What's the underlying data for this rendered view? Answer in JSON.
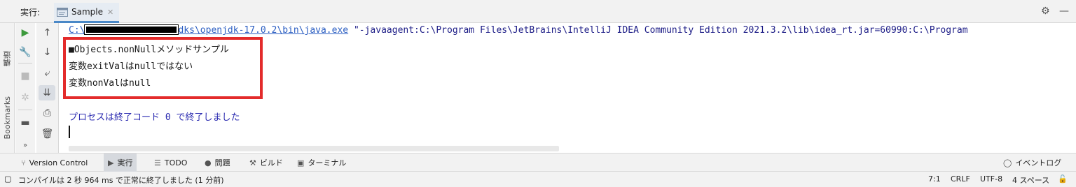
{
  "header": {
    "title": "実行:",
    "tab_label": "Sample",
    "settings_icon": "gear-icon",
    "minimize_icon": "minimize-icon"
  },
  "left_stripe": {
    "structure_label": "構造",
    "bookmarks_label": "Bookmarks"
  },
  "console": {
    "cmd_link_prefix": "C:\\",
    "cmd_link_suffix": "dks\\openjdk-17.0.2\\bin\\java.exe",
    "cmd_rest": " \"-javaagent:C:\\Program Files\\JetBrains\\IntelliJ IDEA Community Edition 2021.3.2\\lib\\idea_rt.jar=60990:C:\\Program",
    "lines": [
      "■Objects.nonNullメソッドサンプル",
      "変数exitValはnullではない",
      "変数nonValはnull"
    ],
    "process_line": "プロセスは終了コード 0 で終了しました"
  },
  "bottom_tabs": [
    {
      "icon": "version-control-icon",
      "label": "Version Control"
    },
    {
      "icon": "run-icon",
      "label": "実行"
    },
    {
      "icon": "todo-icon",
      "label": "TODO"
    },
    {
      "icon": "problems-icon",
      "label": "問題"
    },
    {
      "icon": "build-icon",
      "label": "ビルド"
    },
    {
      "icon": "terminal-icon",
      "label": "ターミナル"
    }
  ],
  "event_log": "イベントログ",
  "status": {
    "message": "コンパイルは 2 秒 964 ms で正常に終了しました (1 分前)",
    "position": "7:1",
    "line_sep": "CRLF",
    "encoding": "UTF-8",
    "indent": "4 スペース"
  },
  "colors": {
    "accent": "#4a88c7",
    "highlight_box": "#e32b2b",
    "link": "#2b5ec2",
    "process_text": "#2a2ab0"
  }
}
